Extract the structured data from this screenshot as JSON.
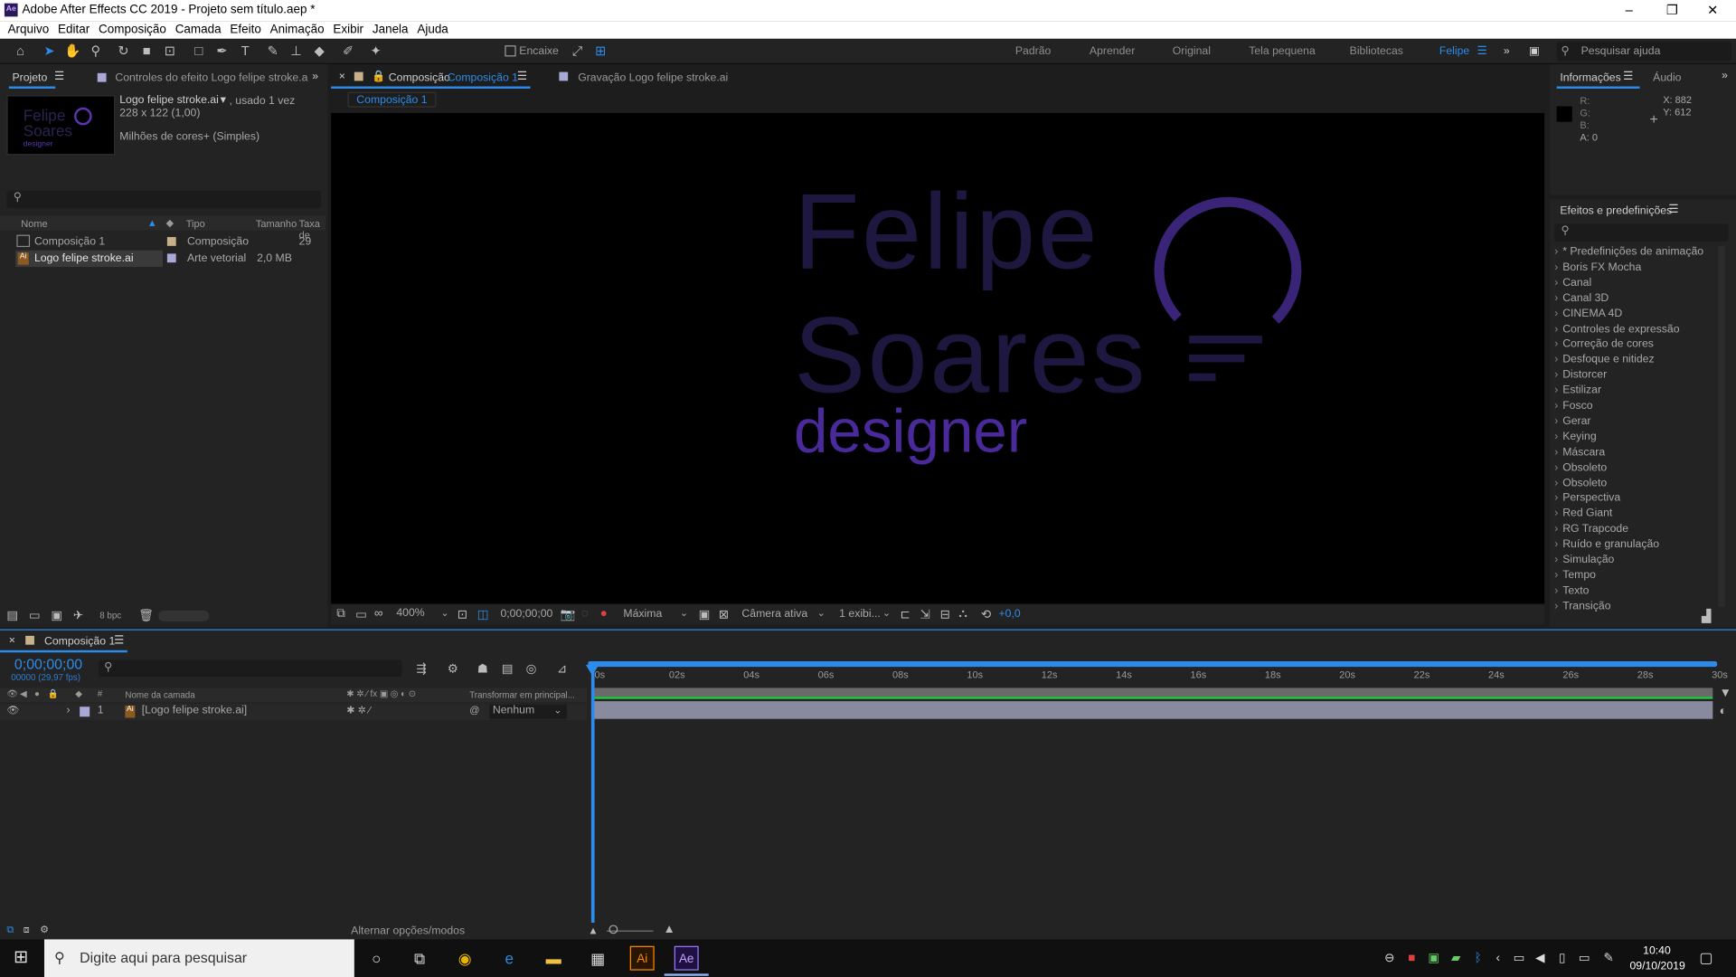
{
  "window": {
    "title": "Adobe After Effects CC 2019 - Projeto sem título.aep *",
    "app_logo": "Ae"
  },
  "menu": [
    "Arquivo",
    "Editar",
    "Composição",
    "Camada",
    "Efeito",
    "Animação",
    "Exibir",
    "Janela",
    "Ajuda"
  ],
  "toolbar": {
    "snap_label": "Encaixe",
    "workspaces": [
      "Padrão",
      "Aprender",
      "Original",
      "Tela pequena",
      "Bibliotecas",
      "Felipe"
    ],
    "active_workspace": "Felipe",
    "search_placeholder": "Pesquisar ajuda"
  },
  "project_panel": {
    "tab": "Projeto",
    "tab2": "Controles do efeito  Logo felipe stroke.a",
    "selected_name": "Logo felipe stroke.ai",
    "used": ", usado 1 vez",
    "dims": "228 x 122 (1,00)",
    "colors": "Milhões de cores+ (Simples)",
    "columns": [
      "Nome",
      "Tipo",
      "Tamanho",
      "Taxa de"
    ],
    "items": [
      {
        "name": "Composição 1",
        "type": "Composição",
        "size": "",
        "rate": "29"
      },
      {
        "name": "Logo felipe stroke.ai",
        "type": "Arte vetorial",
        "size": "2,0 MB",
        "rate": ""
      }
    ],
    "bpc": "8 bpc"
  },
  "comp_panel": {
    "tab_label": "Composição",
    "tab_comp": "Composição 1",
    "tab_footage": "Gravação  Logo felipe stroke.ai",
    "breadcrumb": "Composição 1",
    "logo_line1": "Felipe",
    "logo_line2": "Soares",
    "logo_line3": "designer",
    "zoom": "400%",
    "timecode": "0;00;00;00",
    "resolution": "Máxima",
    "camera": "Câmera ativa",
    "views": "1 exibi...",
    "exposure": "+0,0"
  },
  "info_panel": {
    "tab": "Informações",
    "tab2": "Áudio",
    "r_label": "R:",
    "g_label": "G:",
    "b_label": "B:",
    "a_label": "A:  0",
    "x": "X:  882",
    "y": "Y:  612"
  },
  "effects_panel": {
    "title": "Efeitos e predefinições",
    "items": [
      "* Predefinições de animação",
      "Boris FX Mocha",
      "Canal",
      "Canal 3D",
      "CINEMA 4D",
      "Controles de expressão",
      "Correção de cores",
      "Desfoque e nitidez",
      "Distorcer",
      "Estilizar",
      "Fosco",
      "Gerar",
      "Keying",
      "Máscara",
      "Obsoleto",
      "Obsoleto",
      "Perspectiva",
      "Red Giant",
      "RG Trapcode",
      "Ruído e granulação",
      "Simulação",
      "Tempo",
      "Texto",
      "Transição"
    ]
  },
  "timeline": {
    "tab": "Composição 1",
    "timecode": "0;00;00;00",
    "frames": "00000 (29,97 fps)",
    "col_layer": "Nome da camada",
    "col_parent": "Transformar em principal...",
    "layer_num": "1",
    "layer_name": "[Logo felipe stroke.ai]",
    "parent_value": "Nenhum",
    "toggle_label": "Alternar opções/modos",
    "ticks": [
      "0s",
      "02s",
      "04s",
      "06s",
      "08s",
      "10s",
      "12s",
      "14s",
      "16s",
      "18s",
      "20s",
      "22s",
      "24s",
      "26s",
      "28s",
      "30s"
    ]
  },
  "taskbar": {
    "search": "Digite aqui para pesquisar",
    "time": "10:40",
    "date": "09/10/2019"
  }
}
